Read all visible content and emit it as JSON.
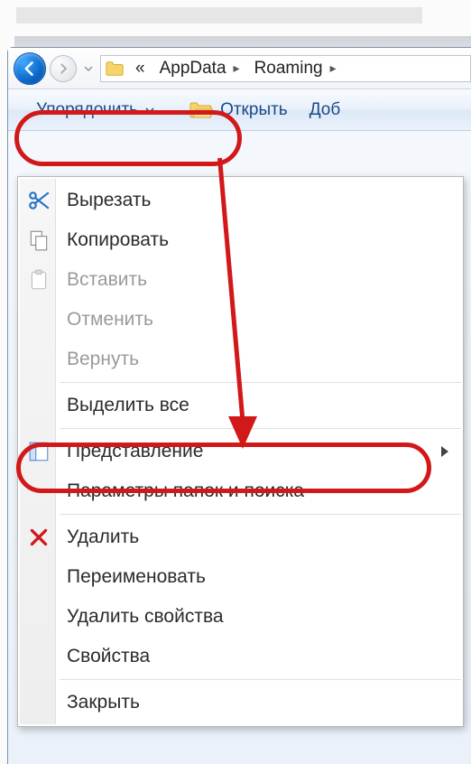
{
  "breadcrumb": {
    "item1": "AppData",
    "item2": "Roaming"
  },
  "toolbar": {
    "organize_label": "Упорядочить",
    "open_label": "Открыть",
    "add_label": "Доб"
  },
  "menu": {
    "cut": "Вырезать",
    "copy": "Копировать",
    "paste": "Вставить",
    "undo": "Отменить",
    "redo": "Вернуть",
    "select_all": "Выделить все",
    "layout": "Представление",
    "folder_options": "Параметры папок и поиска",
    "delete": "Удалить",
    "rename": "Переименовать",
    "remove_properties": "Удалить свойства",
    "properties": "Свойства",
    "close": "Закрыть"
  }
}
